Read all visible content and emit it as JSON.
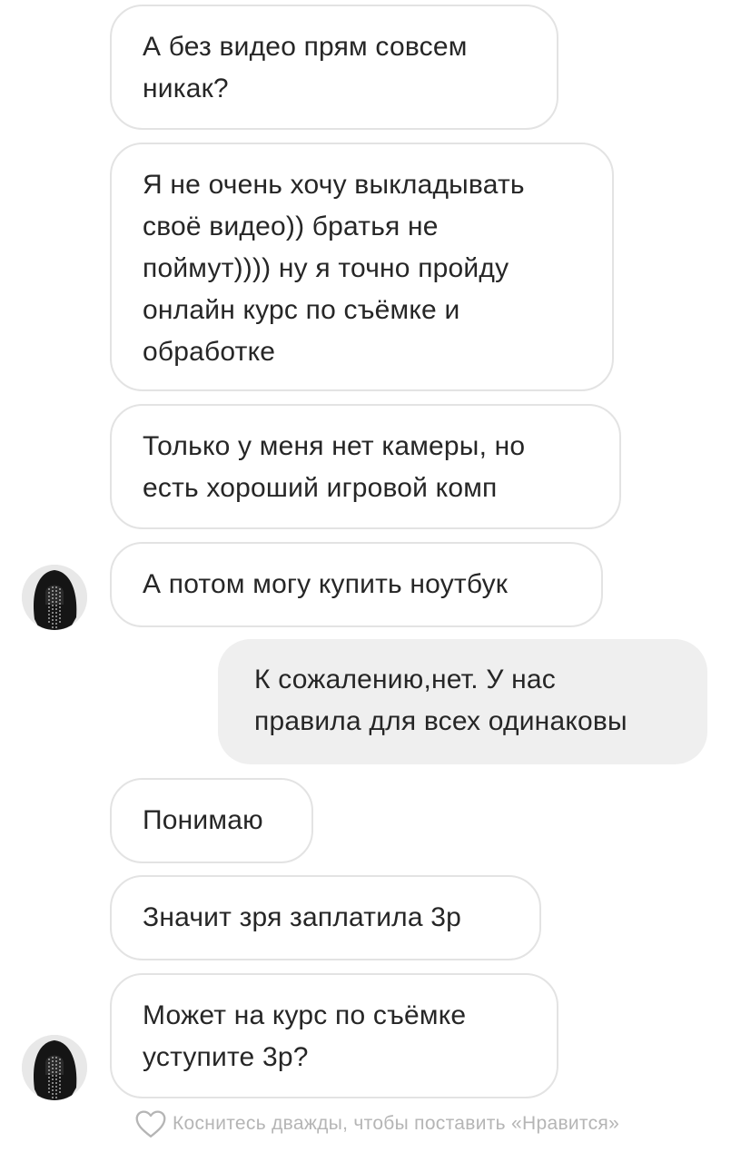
{
  "messages": [
    {
      "lines": [
        "А без видео прям совсем",
        "никак?"
      ]
    },
    {
      "lines": [
        "Я не очень хочу выкладывать",
        "своё видео)) братья не",
        "поймут)))) ну я точно пройду",
        "онлайн курс по съёмке и",
        "обработке"
      ]
    },
    {
      "lines": [
        "Только у меня нет камеры, но",
        "есть хороший игровой комп"
      ]
    },
    {
      "lines": [
        "А потом могу купить ноутбук"
      ]
    },
    {
      "lines": [
        "К сожалению,нет. У нас",
        "правила для всех одинаковы"
      ]
    },
    {
      "lines": [
        "Понимаю"
      ]
    },
    {
      "lines": [
        "Значит зря заплатила 3р"
      ]
    },
    {
      "lines": [
        "Может на курс по съёмке",
        "уступите 3р?"
      ]
    }
  ],
  "like_hint": {
    "icon": "heart-outline-icon",
    "text": "Коснитесь дважды, чтобы поставить «Нравится»"
  },
  "colors": {
    "incoming_bg": "#ffffff",
    "incoming_border": "#e3e3e3",
    "outgoing_bg": "#efefef",
    "text": "#262626",
    "hint": "#b5b5b5"
  }
}
